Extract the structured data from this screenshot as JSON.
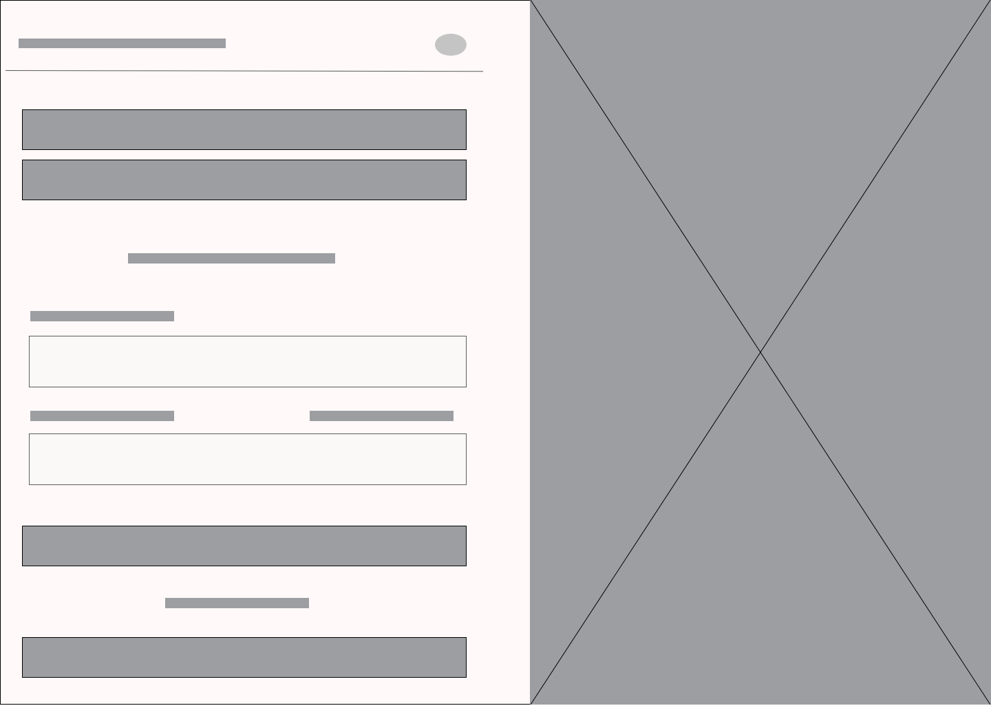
{
  "colors": {
    "panel_background": "#fff9f9",
    "placeholder_bar": "#9d9ea2",
    "avatar_placeholder": "#c4c4c4",
    "input_background": "#fbf9f8",
    "image_placeholder": "#9d9ea2",
    "outline": "#000000"
  },
  "header": {
    "title_text": "",
    "avatar_icon": "avatar-placeholder-icon"
  },
  "form": {
    "primary_button_1_label": "",
    "primary_button_2_label": "",
    "section_heading": "",
    "field_1_label": "",
    "field_1_value": "",
    "field_2_label": "",
    "field_2_secondary_label": "",
    "field_2_value": "",
    "submit_button_label": "",
    "footer_text": "",
    "secondary_button_label": ""
  },
  "image_panel": {
    "icon": "image-placeholder-icon"
  }
}
